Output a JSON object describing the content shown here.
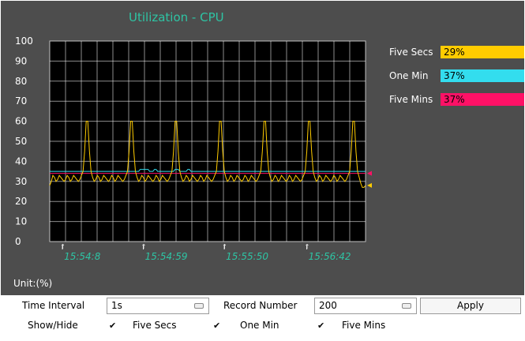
{
  "panel": {
    "title": "Utilization - CPU",
    "unit_label": "Unit:(%)"
  },
  "legend": [
    {
      "label": "Five Secs",
      "value": "29%",
      "color": "#ffcc00"
    },
    {
      "label": "One Min",
      "value": "37%",
      "color": "#33ddee"
    },
    {
      "label": "Five Mins",
      "value": "37%",
      "color": "#ff1166"
    }
  ],
  "chart_data": {
    "type": "line",
    "ylim": [
      0,
      100
    ],
    "y_ticks": [
      "0",
      "10",
      "20",
      "30",
      "40",
      "50",
      "60",
      "70",
      "80",
      "90",
      "100"
    ],
    "x_tick_labels": [
      "15:54:8",
      "15:54:59",
      "15:55:50",
      "15:56:42"
    ],
    "x_tick_index": [
      8,
      59,
      110,
      162
    ],
    "n_points": 200,
    "grid": true,
    "series": [
      {
        "name": "Five Secs",
        "color": "#ffcc00",
        "values": [
          28,
          30,
          33,
          32,
          30,
          31,
          33,
          32,
          31,
          30,
          31,
          33,
          32,
          30,
          31,
          33,
          32,
          31,
          30,
          31,
          33,
          35,
          45,
          60,
          60,
          45,
          35,
          32,
          30,
          31,
          33,
          32,
          30,
          31,
          33,
          32,
          31,
          30,
          31,
          33,
          32,
          30,
          31,
          33,
          32,
          31,
          30,
          31,
          33,
          35,
          45,
          60,
          60,
          45,
          35,
          32,
          30,
          31,
          33,
          32,
          30,
          31,
          33,
          32,
          31,
          30,
          31,
          33,
          32,
          30,
          31,
          33,
          32,
          31,
          30,
          31,
          33,
          35,
          45,
          60,
          60,
          45,
          35,
          32,
          30,
          31,
          33,
          32,
          30,
          31,
          33,
          32,
          31,
          30,
          31,
          33,
          32,
          30,
          31,
          33,
          32,
          31,
          30,
          31,
          33,
          35,
          45,
          60,
          60,
          45,
          35,
          32,
          30,
          31,
          33,
          32,
          30,
          31,
          33,
          32,
          31,
          30,
          31,
          33,
          32,
          30,
          31,
          33,
          32,
          31,
          30,
          31,
          33,
          35,
          45,
          60,
          60,
          45,
          35,
          32,
          30,
          31,
          33,
          32,
          30,
          31,
          33,
          32,
          31,
          30,
          31,
          33,
          32,
          30,
          31,
          33,
          32,
          31,
          30,
          31,
          33,
          35,
          45,
          60,
          60,
          45,
          35,
          32,
          30,
          31,
          33,
          32,
          30,
          31,
          33,
          32,
          31,
          30,
          31,
          33,
          32,
          30,
          31,
          33,
          32,
          31,
          30,
          31,
          33,
          35,
          45,
          60,
          60,
          45,
          35,
          32,
          29,
          27,
          27,
          28
        ]
      },
      {
        "name": "One Min",
        "color": "#33ddee",
        "values": [
          35,
          35,
          35,
          35,
          35,
          35,
          35,
          35,
          35,
          35,
          35,
          35,
          35,
          35,
          35,
          35,
          35,
          35,
          35,
          35,
          35,
          35,
          35,
          35,
          35,
          35,
          35,
          35,
          35,
          35,
          35,
          35,
          35,
          35,
          35,
          35,
          35,
          35,
          35,
          35,
          35,
          35,
          35,
          35,
          35,
          35,
          35,
          35,
          35,
          35,
          35,
          35,
          35,
          35,
          35,
          35,
          35,
          36,
          36,
          36,
          36,
          36,
          36,
          35,
          35,
          35,
          36,
          36,
          35,
          35,
          35,
          35,
          35,
          35,
          35,
          35,
          35,
          35,
          35,
          36,
          36,
          36,
          35,
          35,
          35,
          35,
          35,
          36,
          36,
          35,
          35,
          35,
          35,
          35,
          35,
          35,
          35,
          35,
          35,
          35,
          35,
          35,
          35,
          35,
          35,
          35,
          35,
          35,
          35,
          35,
          35,
          35,
          35,
          35,
          35,
          35,
          35,
          35,
          35,
          35,
          35,
          35,
          35,
          35,
          35,
          35,
          35,
          35,
          35,
          35,
          35,
          35,
          35,
          35,
          35,
          35,
          35,
          35,
          35,
          35,
          35,
          35,
          35,
          35,
          35,
          35,
          35,
          35,
          35,
          35,
          35,
          35,
          35,
          35,
          35,
          35,
          35,
          35,
          35,
          35,
          35,
          35,
          35,
          35,
          35,
          35,
          35,
          35,
          35,
          35,
          35,
          35,
          35,
          35,
          35,
          35,
          35,
          35,
          35,
          35,
          35,
          35,
          35,
          35,
          35,
          35,
          35,
          35,
          35,
          35,
          35,
          35,
          35,
          35,
          35,
          35,
          35,
          35,
          35,
          35
        ]
      },
      {
        "name": "Five Mins",
        "color": "#ff1166",
        "values": [
          34,
          34,
          34,
          34,
          34,
          34,
          34,
          34,
          34,
          34,
          34,
          34,
          34,
          34,
          34,
          34,
          34,
          34,
          34,
          34,
          34,
          34,
          34,
          34,
          34,
          34,
          34,
          34,
          34,
          34,
          34,
          34,
          34,
          34,
          34,
          34,
          34,
          34,
          34,
          34,
          34,
          34,
          34,
          34,
          34,
          34,
          34,
          34,
          34,
          34,
          34,
          34,
          34,
          34,
          34,
          34,
          34,
          34,
          34,
          34,
          34,
          34,
          34,
          34,
          34,
          34,
          34,
          34,
          34,
          34,
          34,
          34,
          34,
          34,
          34,
          34,
          34,
          34,
          34,
          34,
          34,
          34,
          34,
          34,
          34,
          34,
          34,
          34,
          34,
          34,
          34,
          34,
          34,
          34,
          34,
          34,
          34,
          34,
          34,
          34,
          34,
          34,
          34,
          34,
          34,
          34,
          34,
          34,
          34,
          34,
          34,
          34,
          34,
          34,
          34,
          34,
          34,
          34,
          34,
          34,
          34,
          34,
          34,
          34,
          34,
          34,
          34,
          34,
          34,
          34,
          34,
          34,
          34,
          34,
          34,
          34,
          34,
          34,
          34,
          34,
          34,
          34,
          34,
          34,
          34,
          34,
          34,
          34,
          34,
          34,
          34,
          34,
          34,
          34,
          34,
          34,
          34,
          34,
          34,
          34,
          34,
          34,
          34,
          34,
          34,
          34,
          34,
          34,
          34,
          34,
          34,
          34,
          34,
          34,
          34,
          34,
          34,
          34,
          34,
          34,
          34,
          34,
          34,
          34,
          34,
          34,
          34,
          34,
          34,
          34,
          34,
          34,
          34,
          34,
          34,
          34,
          34,
          34,
          34,
          34
        ]
      }
    ]
  },
  "controls": {
    "time_interval_label": "Time Interval",
    "time_interval_value": "1s",
    "record_number_label": "Record Number",
    "record_number_value": "200",
    "apply_label": "Apply",
    "show_hide_label": "Show/Hide",
    "check_mark": "✔",
    "checkboxes": [
      {
        "label": "Five Secs",
        "checked": true
      },
      {
        "label": "One Min",
        "checked": true
      },
      {
        "label": "Five Mins",
        "checked": true
      }
    ]
  }
}
